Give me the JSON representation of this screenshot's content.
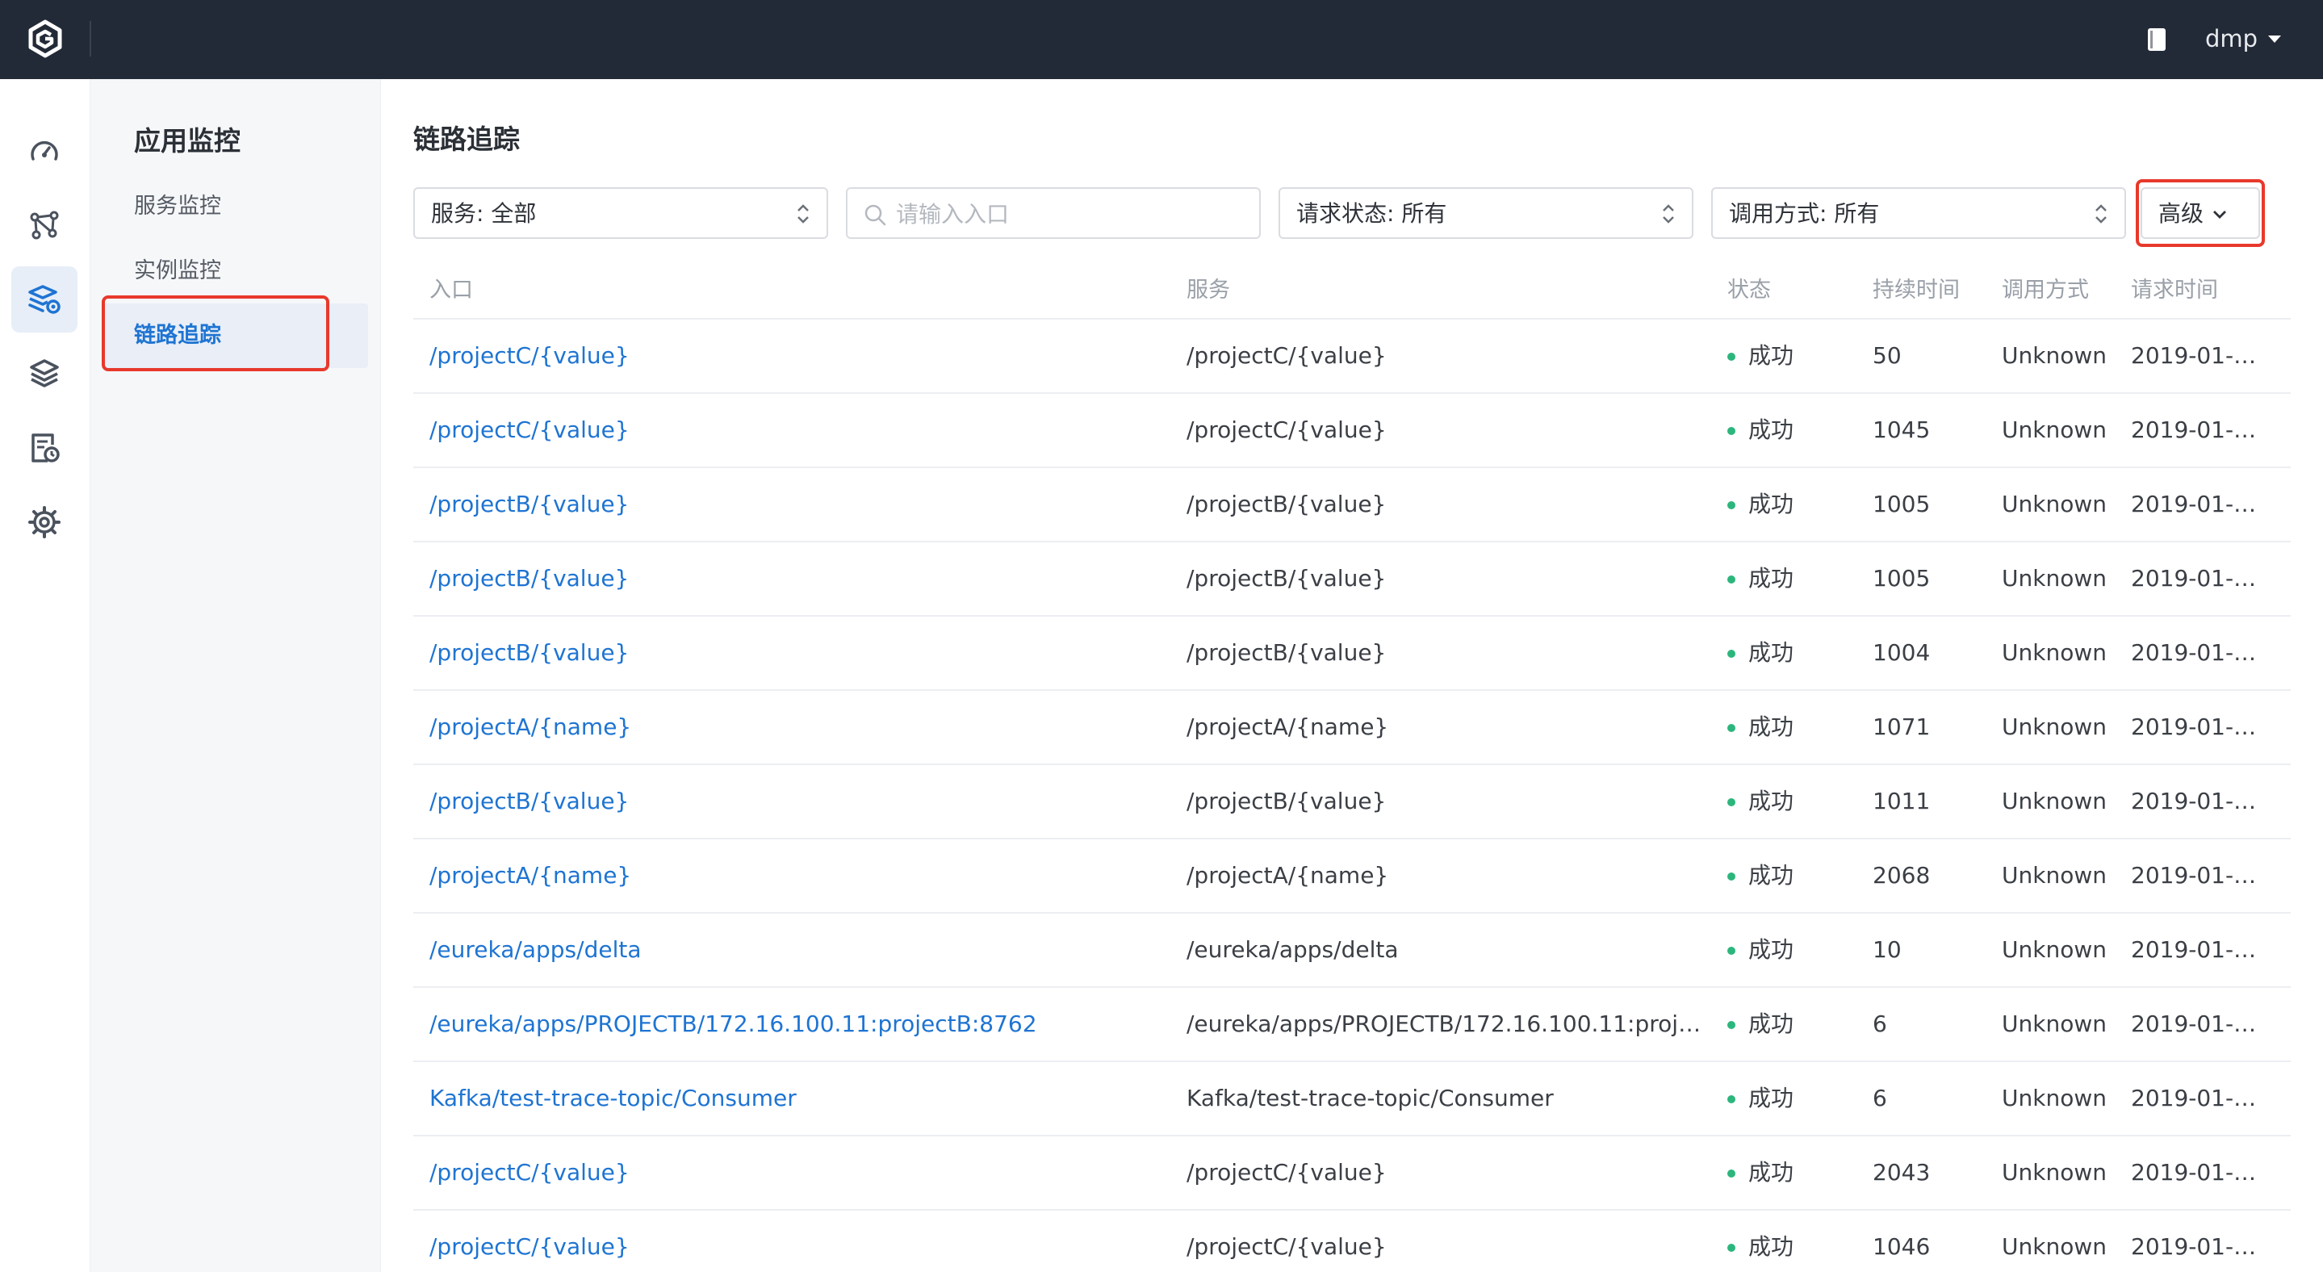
{
  "topbar": {
    "user": "dmp",
    "icons": [
      "logo-g-icon",
      "document-icon",
      "caret-down-icon"
    ]
  },
  "rail": {
    "items": [
      "dashboard-gauge-icon",
      "topology-icon",
      "app-monitor-icon",
      "layers-icon",
      "log-clock-icon",
      "settings-gear-icon"
    ],
    "active_index": 2,
    "expand_icon": "expand-sidebar-icon"
  },
  "subnav": {
    "title": "应用监控",
    "items": [
      {
        "label": "服务监控"
      },
      {
        "label": "实例监控"
      },
      {
        "label": "链路追踪",
        "active": true
      }
    ]
  },
  "main": {
    "title": "链路追踪",
    "filters": {
      "service": "服务: 全部",
      "search_placeholder": "请输入入口",
      "request_status": "请求状态: 所有",
      "call_method": "调用方式: 所有",
      "advanced": "高级"
    },
    "table": {
      "columns": [
        "入口",
        "服务",
        "状态",
        "持续时间",
        "调用方式",
        "请求时间"
      ],
      "rows": [
        {
          "entry": "/projectC/{value}",
          "service": "/projectC/{value}",
          "status": "成功",
          "duration": "50",
          "call": "Unknown",
          "time": "2019-01-3..."
        },
        {
          "entry": "/projectC/{value}",
          "service": "/projectC/{value}",
          "status": "成功",
          "duration": "1045",
          "call": "Unknown",
          "time": "2019-01-3..."
        },
        {
          "entry": "/projectB/{value}",
          "service": "/projectB/{value}",
          "status": "成功",
          "duration": "1005",
          "call": "Unknown",
          "time": "2019-01-3..."
        },
        {
          "entry": "/projectB/{value}",
          "service": "/projectB/{value}",
          "status": "成功",
          "duration": "1005",
          "call": "Unknown",
          "time": "2019-01-3..."
        },
        {
          "entry": "/projectB/{value}",
          "service": "/projectB/{value}",
          "status": "成功",
          "duration": "1004",
          "call": "Unknown",
          "time": "2019-01-3..."
        },
        {
          "entry": "/projectA/{name}",
          "service": "/projectA/{name}",
          "status": "成功",
          "duration": "1071",
          "call": "Unknown",
          "time": "2019-01-3..."
        },
        {
          "entry": "/projectB/{value}",
          "service": "/projectB/{value}",
          "status": "成功",
          "duration": "1011",
          "call": "Unknown",
          "time": "2019-01-3..."
        },
        {
          "entry": "/projectA/{name}",
          "service": "/projectA/{name}",
          "status": "成功",
          "duration": "2068",
          "call": "Unknown",
          "time": "2019-01-3..."
        },
        {
          "entry": "/eureka/apps/delta",
          "service": "/eureka/apps/delta",
          "status": "成功",
          "duration": "10",
          "call": "Unknown",
          "time": "2019-01-3..."
        },
        {
          "entry": "/eureka/apps/PROJECTB/172.16.100.11:projectB:8762",
          "service": "/eureka/apps/PROJECTB/172.16.100.11:proje...",
          "status": "成功",
          "duration": "6",
          "call": "Unknown",
          "time": "2019-01-3..."
        },
        {
          "entry": "Kafka/test-trace-topic/Consumer",
          "service": "Kafka/test-trace-topic/Consumer",
          "status": "成功",
          "duration": "6",
          "call": "Unknown",
          "time": "2019-01-3..."
        },
        {
          "entry": "/projectC/{value}",
          "service": "/projectC/{value}",
          "status": "成功",
          "duration": "2043",
          "call": "Unknown",
          "time": "2019-01-3..."
        },
        {
          "entry": "/projectC/{value}",
          "service": "/projectC/{value}",
          "status": "成功",
          "duration": "1046",
          "call": "Unknown",
          "time": "2019-01-3..."
        }
      ]
    }
  },
  "colors": {
    "topbar": "#232a37",
    "link": "#1e74d2",
    "success": "#2cb67d",
    "highlight_box": "#e8392c"
  }
}
